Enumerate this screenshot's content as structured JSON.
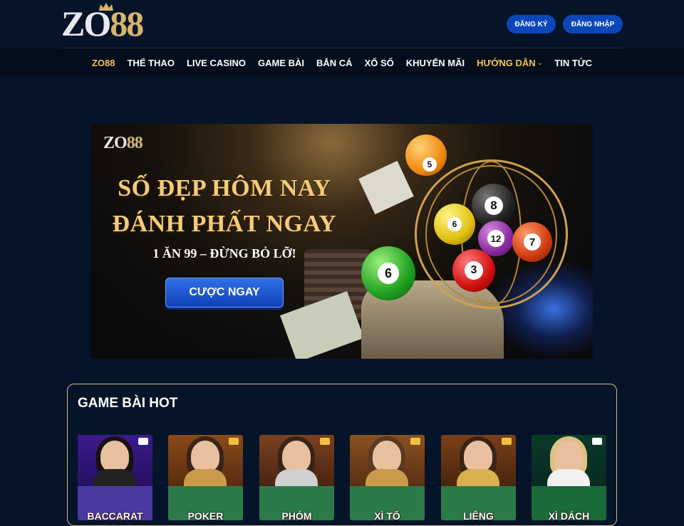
{
  "header": {
    "logo_text_zo": "ZO",
    "logo_text_num": "88",
    "register_label": "ĐĂNG KÝ",
    "login_label": "ĐĂNG NHẬP"
  },
  "nav": {
    "items": [
      {
        "label": "ZO88",
        "active": true
      },
      {
        "label": "THỂ THAO"
      },
      {
        "label": "LIVE CASINO"
      },
      {
        "label": "GAME BÀI"
      },
      {
        "label": "BẮN CÁ"
      },
      {
        "label": "XỔ SỐ"
      },
      {
        "label": "KHUYẾN MÃI"
      },
      {
        "label": "HƯỚNG DẪN",
        "has_dropdown": true
      },
      {
        "label": "TIN TỨC"
      }
    ]
  },
  "banner": {
    "logo_zo": "ZO",
    "logo_num": "88",
    "headline_1": "SỐ ĐẸP HÔM NAY",
    "headline_2": "ĐÁNH PHẤT NGAY",
    "subline": "1 ĂN 99 – ĐỪNG BỎ LỠ!",
    "cta_label": "CƯỢC NGAY",
    "balls": [
      "5",
      "8",
      "6",
      "12",
      "7",
      "3",
      "6"
    ]
  },
  "game_section": {
    "title": "GAME BÀI HOT",
    "games": [
      {
        "label": "BACCARAT"
      },
      {
        "label": "POKER"
      },
      {
        "label": "PHỎM"
      },
      {
        "label": "XÌ TỐ"
      },
      {
        "label": "LIÊNG"
      },
      {
        "label": "XÌ DÁCH"
      }
    ]
  },
  "colors": {
    "background": "#06142a",
    "accent_gold": "#f0c25c",
    "button_blue": "#0b47b8",
    "panel_border": "#d5be8a"
  }
}
